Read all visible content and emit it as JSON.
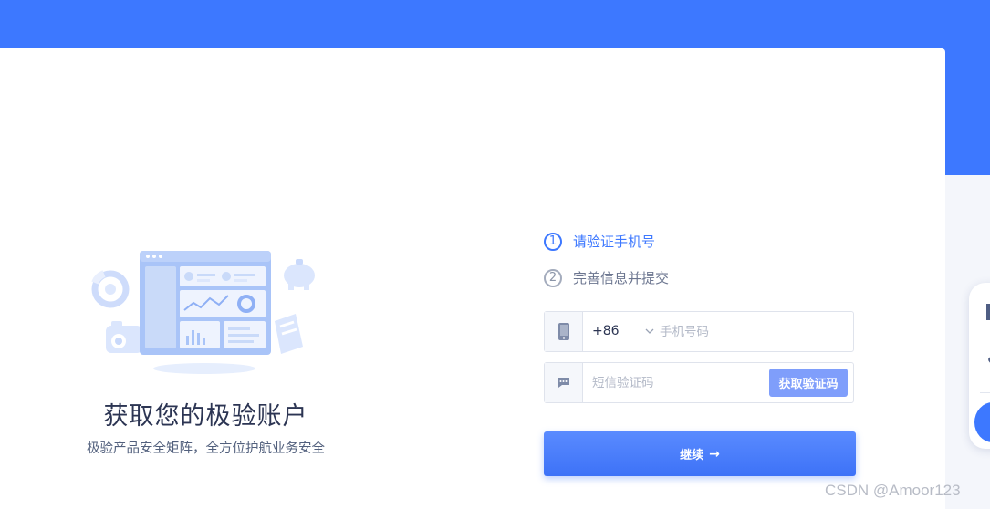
{
  "hero": {
    "title": "获取您的极验账户",
    "subtitle": "极验产品安全矩阵，全方位护航业务安全"
  },
  "steps": [
    {
      "number": "1",
      "label": "请验证手机号",
      "state": "active"
    },
    {
      "number": "2",
      "label": "完善信息并提交",
      "state": "inactive"
    }
  ],
  "phone": {
    "icon": "phone-icon",
    "country_code": "+86",
    "placeholder": "手机号码"
  },
  "sms": {
    "icon": "message-icon",
    "placeholder": "短信验证码",
    "button_label": "获取验证码"
  },
  "continue": {
    "label": "继续",
    "arrow": "→"
  },
  "watermark": "CSDN @Amoor123",
  "colors": {
    "brand_blue": "#3d78ff",
    "sms_button": "#7f9efb",
    "title_text": "#2c3553"
  }
}
